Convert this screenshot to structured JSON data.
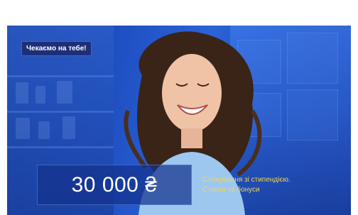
{
  "banner": {
    "tag": "Чекаємо на тебе!",
    "amount": "30 000 ₴",
    "subtitle_line1": "Стажування зі стипендією.",
    "subtitle_line2": "Ставка та бонуси"
  },
  "colors": {
    "background": "#1f4fc2",
    "tag_bg": "#1d2f78",
    "subtitle": "#f0d64a",
    "amount_text": "#ffffff"
  }
}
